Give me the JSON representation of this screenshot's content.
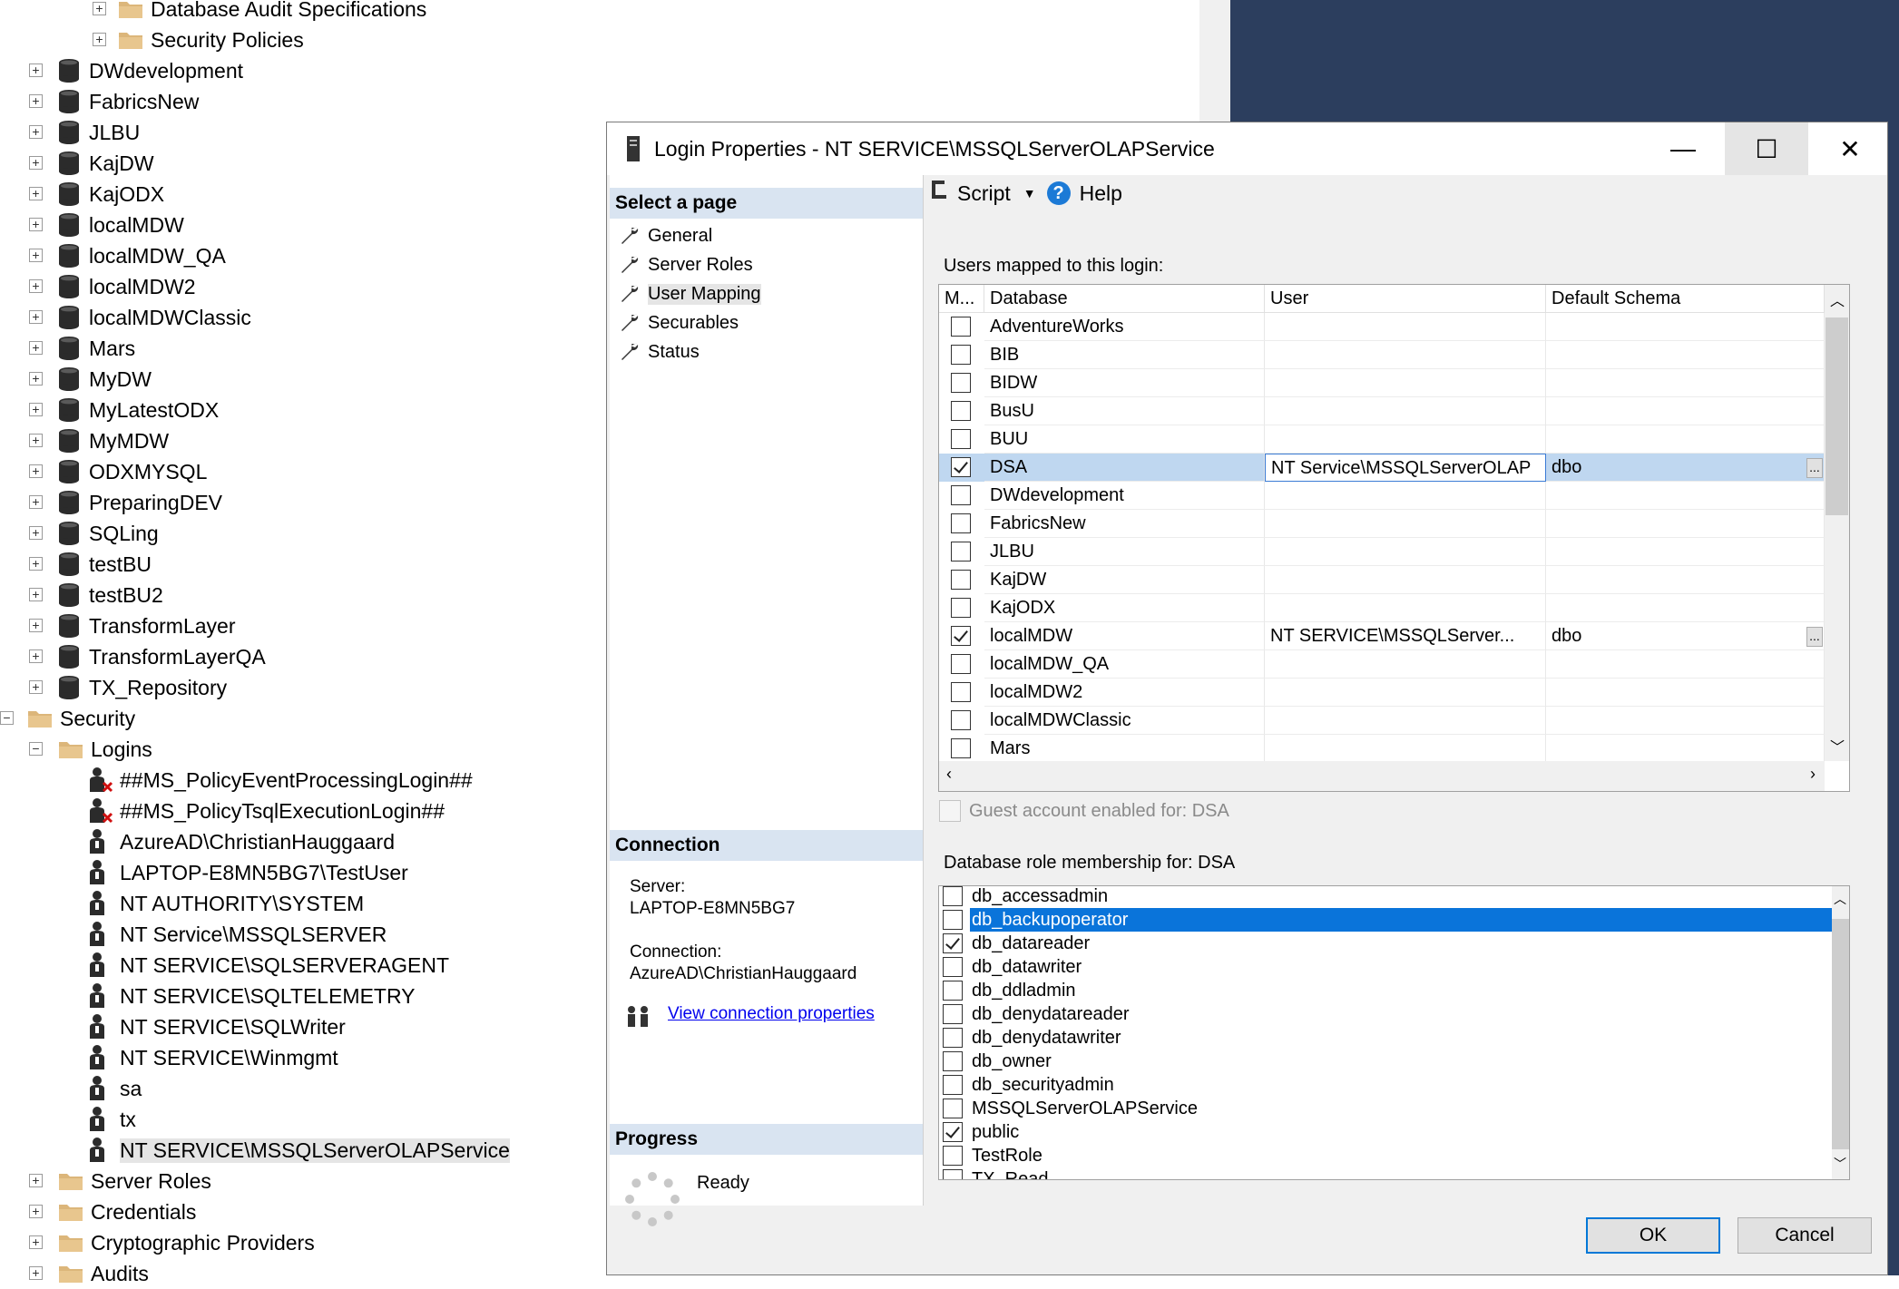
{
  "tree": {
    "items": [
      {
        "label": "Database Audit Specifications",
        "icon": "folder-icon",
        "level": 2
      },
      {
        "label": "Security Policies",
        "icon": "folder-icon",
        "level": 2
      },
      {
        "label": "DWdevelopment",
        "icon": "database-icon",
        "level": 1
      },
      {
        "label": "FabricsNew",
        "icon": "database-icon",
        "level": 1
      },
      {
        "label": "JLBU",
        "icon": "database-icon",
        "level": 1
      },
      {
        "label": "KajDW",
        "icon": "database-icon",
        "level": 1
      },
      {
        "label": "KajODX",
        "icon": "database-icon",
        "level": 1
      },
      {
        "label": "localMDW",
        "icon": "database-icon",
        "level": 1
      },
      {
        "label": "localMDW_QA",
        "icon": "database-icon",
        "level": 1
      },
      {
        "label": "localMDW2",
        "icon": "database-icon",
        "level": 1
      },
      {
        "label": "localMDWClassic",
        "icon": "database-icon",
        "level": 1
      },
      {
        "label": "Mars",
        "icon": "database-icon",
        "level": 1
      },
      {
        "label": "MyDW",
        "icon": "database-icon",
        "level": 1
      },
      {
        "label": "MyLatestODX",
        "icon": "database-icon",
        "level": 1
      },
      {
        "label": "MyMDW",
        "icon": "database-icon",
        "level": 1
      },
      {
        "label": "ODXMYSQL",
        "icon": "database-icon",
        "level": 1
      },
      {
        "label": "PreparingDEV",
        "icon": "database-icon",
        "level": 1
      },
      {
        "label": "SQLing",
        "icon": "database-icon",
        "level": 1
      },
      {
        "label": "testBU",
        "icon": "database-icon",
        "level": 1
      },
      {
        "label": "testBU2",
        "icon": "database-icon",
        "level": 1
      },
      {
        "label": "TransformLayer",
        "icon": "database-icon",
        "level": 1
      },
      {
        "label": "TransformLayerQA",
        "icon": "database-icon",
        "level": 1
      },
      {
        "label": "TX_Repository",
        "icon": "database-icon",
        "level": 1
      },
      {
        "label": "Security",
        "icon": "folder-icon",
        "level": 0
      },
      {
        "label": "Logins",
        "icon": "folder-icon",
        "level": 1
      },
      {
        "label": "##MS_PolicyEventProcessingLogin##",
        "icon": "disabled-login-icon",
        "level": 2
      },
      {
        "label": "##MS_PolicyTsqlExecutionLogin##",
        "icon": "disabled-login-icon",
        "level": 2
      },
      {
        "label": "AzureAD\\ChristianHauggaard",
        "icon": "login-icon",
        "level": 2
      },
      {
        "label": "LAPTOP-E8MN5BG7\\TestUser",
        "icon": "login-icon",
        "level": 2
      },
      {
        "label": "NT AUTHORITY\\SYSTEM",
        "icon": "login-icon",
        "level": 2
      },
      {
        "label": "NT Service\\MSSQLSERVER",
        "icon": "login-icon",
        "level": 2
      },
      {
        "label": "NT SERVICE\\SQLSERVERAGENT",
        "icon": "login-icon",
        "level": 2
      },
      {
        "label": "NT SERVICE\\SQLTELEMETRY",
        "icon": "login-icon",
        "level": 2
      },
      {
        "label": "NT SERVICE\\SQLWriter",
        "icon": "login-icon",
        "level": 2
      },
      {
        "label": "NT SERVICE\\Winmgmt",
        "icon": "login-icon",
        "level": 2
      },
      {
        "label": "sa",
        "icon": "login-icon",
        "level": 2
      },
      {
        "label": "tx",
        "icon": "login-icon",
        "level": 2
      },
      {
        "label": "NT SERVICE\\MSSQLServerOLAPService",
        "icon": "login-icon",
        "level": 2,
        "selected": true
      },
      {
        "label": "Server Roles",
        "icon": "folder-icon",
        "level": 1
      },
      {
        "label": "Credentials",
        "icon": "folder-icon",
        "level": 1
      },
      {
        "label": "Cryptographic Providers",
        "icon": "folder-icon",
        "level": 1
      },
      {
        "label": "Audits",
        "icon": "folder-icon",
        "level": 1
      }
    ]
  },
  "dialog": {
    "title": "Login Properties - NT SERVICE\\MSSQLServerOLAPService",
    "minimize": "—",
    "maximize": "☐",
    "close": "✕",
    "select_page_header": "Select a page",
    "pages": [
      "General",
      "Server Roles",
      "User Mapping",
      "Securables",
      "Status"
    ],
    "active_page": "User Mapping",
    "connection_header": "Connection",
    "server_label": "Server:",
    "server_value": "LAPTOP-E8MN5BG7",
    "connection_label": "Connection:",
    "connection_value": "AzureAD\\ChristianHauggaard",
    "view_connection": "View connection properties",
    "progress_header": "Progress",
    "progress_status": "Ready",
    "toolbar": {
      "script": "Script",
      "help": "Help"
    },
    "users_mapped_label": "Users mapped to this login:",
    "grid_headers": [
      "M...",
      "Database",
      "User",
      "Default Schema"
    ],
    "mappings": [
      {
        "map": false,
        "database": "AdventureWorks",
        "user": "",
        "schema": ""
      },
      {
        "map": false,
        "database": "BIB",
        "user": "",
        "schema": ""
      },
      {
        "map": false,
        "database": "BIDW",
        "user": "",
        "schema": ""
      },
      {
        "map": false,
        "database": "BusU",
        "user": "",
        "schema": ""
      },
      {
        "map": false,
        "database": "BUU",
        "user": "",
        "schema": ""
      },
      {
        "map": true,
        "database": "DSA",
        "user": "NT Service\\MSSQLServerOLAP",
        "schema": "dbo",
        "selected": true,
        "ellipsis": "..."
      },
      {
        "map": false,
        "database": "DWdevelopment",
        "user": "",
        "schema": ""
      },
      {
        "map": false,
        "database": "FabricsNew",
        "user": "",
        "schema": ""
      },
      {
        "map": false,
        "database": "JLBU",
        "user": "",
        "schema": ""
      },
      {
        "map": false,
        "database": "KajDW",
        "user": "",
        "schema": ""
      },
      {
        "map": false,
        "database": "KajODX",
        "user": "",
        "schema": ""
      },
      {
        "map": true,
        "database": "localMDW",
        "user": "NT SERVICE\\MSSQLServer...",
        "schema": "dbo",
        "ellipsis": "..."
      },
      {
        "map": false,
        "database": "localMDW_QA",
        "user": "",
        "schema": ""
      },
      {
        "map": false,
        "database": "localMDW2",
        "user": "",
        "schema": ""
      },
      {
        "map": false,
        "database": "localMDWClassic",
        "user": "",
        "schema": ""
      },
      {
        "map": false,
        "database": "Mars",
        "user": "",
        "schema": ""
      }
    ],
    "guest_label": "Guest account enabled for: DSA",
    "role_membership_label": "Database role membership for: DSA",
    "roles": [
      {
        "name": "db_accessadmin",
        "checked": false
      },
      {
        "name": "db_backupoperator",
        "checked": false,
        "selected": true
      },
      {
        "name": "db_datareader",
        "checked": true
      },
      {
        "name": "db_datawriter",
        "checked": false
      },
      {
        "name": "db_ddladmin",
        "checked": false
      },
      {
        "name": "db_denydatareader",
        "checked": false
      },
      {
        "name": "db_denydatawriter",
        "checked": false
      },
      {
        "name": "db_owner",
        "checked": false
      },
      {
        "name": "db_securityadmin",
        "checked": false
      },
      {
        "name": "MSSQLServerOLAPService",
        "checked": false
      },
      {
        "name": "public",
        "checked": true
      },
      {
        "name": "TestRole",
        "checked": false
      },
      {
        "name": "TX_Read...",
        "checked": false
      }
    ],
    "ok_label": "OK",
    "cancel_label": "Cancel"
  },
  "colors": {
    "selection_row": "#bfd7f0",
    "selected_role": "#0a74da",
    "pane_header": "#d9e4f1",
    "background_dark": "#2c3e5e"
  }
}
